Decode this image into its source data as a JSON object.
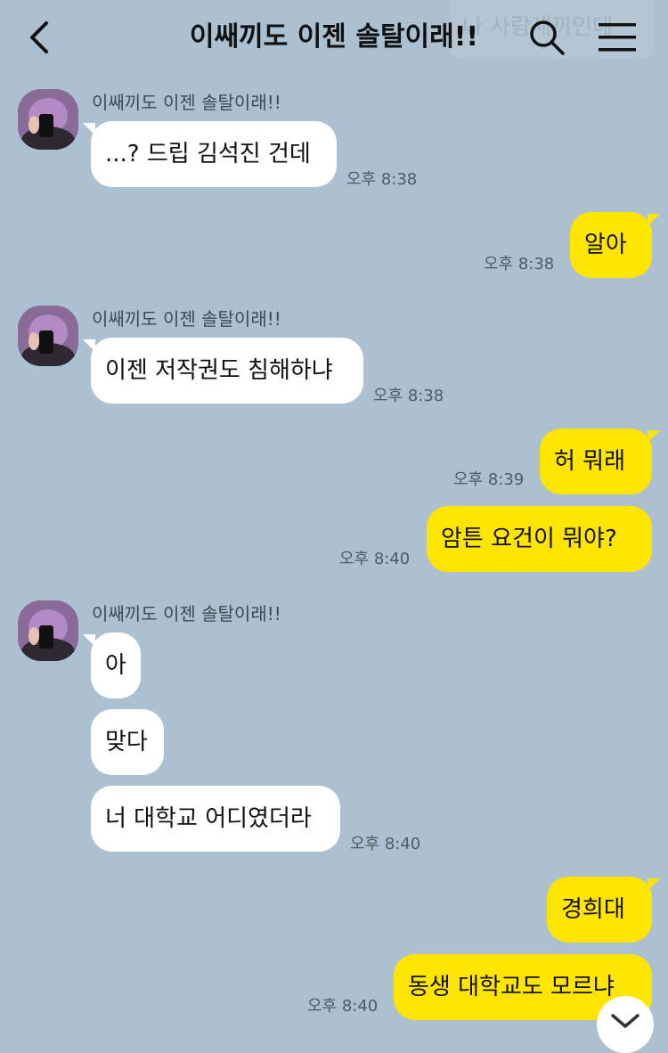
{
  "header": {
    "title": "이쌔끼도 이젠 솔탈이래!!",
    "ghost_text": "나 사람새끼인데"
  },
  "icons": {
    "back": "chevron-left-icon",
    "search": "search-icon",
    "menu": "hamburger-menu-icon",
    "scroll_down": "chevron-down-icon"
  },
  "colors": {
    "background": "#abc1d1",
    "incoming_bubble": "#ffffff",
    "outgoing_bubble": "#fee500"
  },
  "messages": {
    "g1": {
      "sender": "이쌔끼도 이젠 솔탈이래!!",
      "m1": "...? 드립 김석진 건데",
      "time": "오후 8:38"
    },
    "o1": {
      "text": "알아",
      "time": "오후 8:38"
    },
    "g2": {
      "sender": "이쌔끼도 이젠 솔탈이래!!",
      "m1": "이젠 저작권도 침해하냐",
      "time": "오후 8:38"
    },
    "o2": {
      "text": "허 뭐래",
      "time": "오후 8:39"
    },
    "o3": {
      "text": "암튼 요건이 뭐야?",
      "time": "오후 8:40"
    },
    "g3": {
      "sender": "이쌔끼도 이젠 솔탈이래!!",
      "m1": "아",
      "m2": "맞다",
      "m3": "너 대학교 어디였더라",
      "time": "오후 8:40"
    },
    "o4": {
      "text": "경희대"
    },
    "o5": {
      "text": "동생 대학교도 모르냐",
      "time": "오후 8:40"
    }
  }
}
